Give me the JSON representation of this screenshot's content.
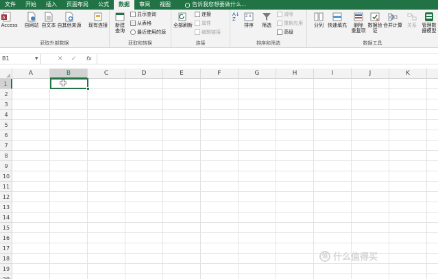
{
  "ribbon_tabs": [
    "文件",
    "开始",
    "插入",
    "页面布局",
    "公式",
    "数据",
    "审阅",
    "视图"
  ],
  "active_tab": "数据",
  "tell_me": "告诉我您想要做什么...",
  "groups": {
    "external": {
      "label": "获取外部数据",
      "buttons": [
        "自 Access",
        "自网站",
        "自文本",
        "自其他来源",
        "现有连接"
      ]
    },
    "transform": {
      "label": "获取和转换",
      "new_query": "新建\n查询",
      "small": [
        "显示查询",
        "从表格",
        "最近使用的源"
      ]
    },
    "connections": {
      "label": "连接",
      "refresh_all": "全部刷新",
      "small": [
        "连接",
        "属性",
        "编辑链接"
      ]
    },
    "sort_filter": {
      "label": "排序和筛选",
      "sort": "排序",
      "filter": "筛选",
      "small": [
        "清除",
        "重新应用",
        "高级"
      ]
    },
    "data_tools": {
      "label": "数据工具",
      "buttons": [
        "分列",
        "快速填充",
        "删除\n重复项",
        "数据验\n证",
        "合并计算",
        "关系",
        "管理数\n据模型"
      ]
    }
  },
  "formula_bar": {
    "name_box": "B1",
    "cancel": "✕",
    "enter": "✓",
    "fx": "fx",
    "value": ""
  },
  "columns": [
    "A",
    "B",
    "C",
    "D",
    "E",
    "F",
    "G",
    "H",
    "I",
    "J",
    "K"
  ],
  "rows": [
    "1",
    "2",
    "3",
    "4",
    "5",
    "6",
    "7",
    "8",
    "9",
    "10",
    "11",
    "12",
    "13",
    "14",
    "15",
    "16",
    "17",
    "18",
    "19",
    "20"
  ],
  "selected_cell": {
    "column": "B",
    "row": "1"
  },
  "watermark": "什么值得买",
  "watermark_badge": "值",
  "colors": {
    "accent": "#217346",
    "ribbon": "#f3f3f3"
  }
}
